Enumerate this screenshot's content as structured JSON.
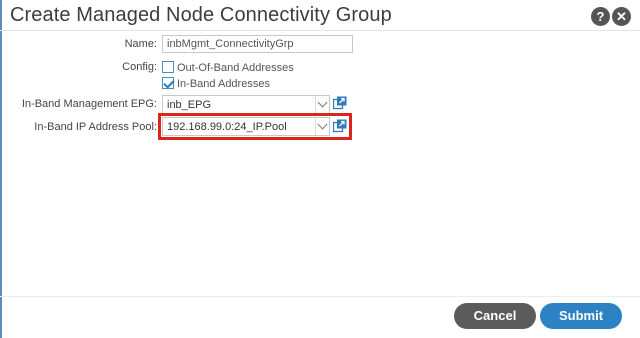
{
  "dialog": {
    "title": "Create Managed Node Connectivity Group",
    "help_label": "?",
    "close_label": "✕"
  },
  "form": {
    "name": {
      "label": "Name:",
      "value": "inbMgmt_ConnectivityGrp"
    },
    "config": {
      "label": "Config:",
      "options": [
        {
          "label": "Out-Of-Band Addresses",
          "checked": false
        },
        {
          "label": "In-Band Addresses",
          "checked": true
        }
      ]
    },
    "inband_epg": {
      "label": "In-Band Management EPG:",
      "value": "inb_EPG"
    },
    "inband_pool": {
      "label": "In-Band IP Address Pool:",
      "value": "192.168.99.0:24_IP.Pool"
    }
  },
  "footer": {
    "cancel_label": "Cancel",
    "submit_label": "Submit"
  },
  "colors": {
    "accent": "#2c82c2",
    "highlight": "#d9251c",
    "cancel": "#5b5b5b"
  }
}
